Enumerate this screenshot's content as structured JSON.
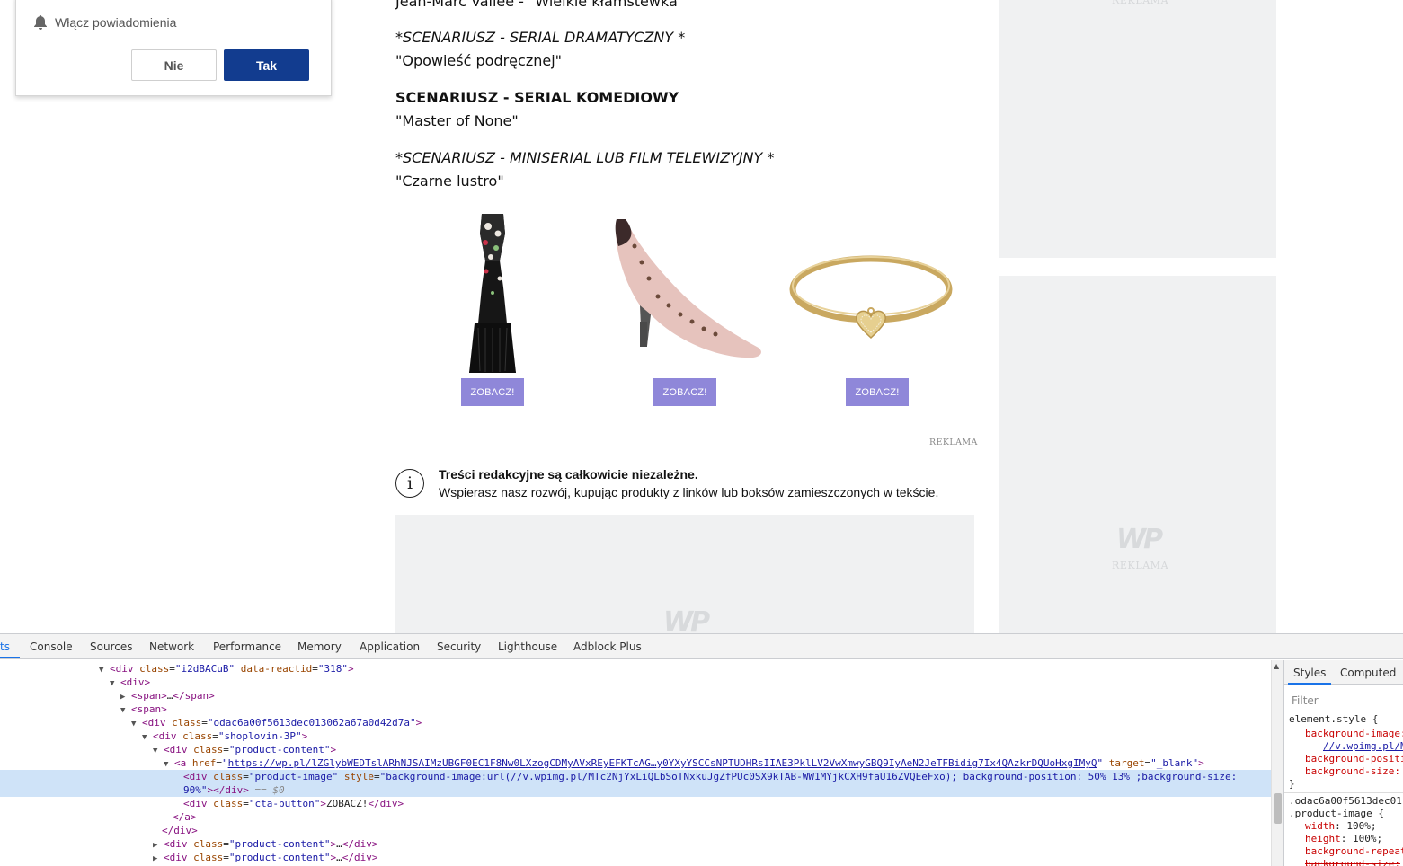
{
  "notification": {
    "text": "Włącz powiadomienia",
    "no_label": "Nie",
    "yes_label": "Tak",
    "accent_color": "#123c8f"
  },
  "article": {
    "partial_top_line": "Jean-Marc Vallée - \"Wielkie kłamstewka\"",
    "sections": [
      {
        "category": "*SCENARIUSZ - SERIAL DRAMATYCZNY *",
        "winner": "\"Opowieść podręcznej\""
      },
      {
        "category": "SCENARIUSZ - SERIAL KOMEDIOWY",
        "winner": "\"Master of None\""
      },
      {
        "category": "*SCENARIUSZ - MINISERIAL LUB FILM TELEWIZYJNY *",
        "winner": "\"Czarne lustro\""
      }
    ]
  },
  "products": [
    {
      "icon": "dress-image",
      "cta": "ZOBACZ!"
    },
    {
      "icon": "high-heel-shoe-image",
      "cta": "ZOBACZ!"
    },
    {
      "icon": "heart-bracelet-image",
      "cta": "ZOBACZ!"
    }
  ],
  "cta_color": "#8f87d9",
  "ad_small_label": "REKLAMA",
  "info": {
    "icon": "info-icon",
    "title": "Treści redakcyjne są całkowicie niezależne.",
    "text": "Wspierasz nasz rozwój, kupując produkty z linków lub boksów zamieszczonych w tekście."
  },
  "ads": {
    "logo": "WP",
    "label": "REKLAMA"
  },
  "devtools": {
    "tabs": [
      "ts",
      "Console",
      "Sources",
      "Network",
      "Performance",
      "Memory",
      "Application",
      "Security",
      "Lighthouse",
      "Adblock Plus"
    ],
    "dom": {
      "r1_tag": "div",
      "r1_attr": "class",
      "r1_val": "i2dBACuB",
      "r1_attr2": "data-reactid",
      "r1_val2": "318",
      "r2_tag": "div",
      "r3_tag": "span",
      "r3_ellipsis": "…",
      "r4_tag": "span",
      "r5_tag": "div",
      "r5_attr": "class",
      "r5_val": "odac6a00f5613dec013062a67a0d42d7a",
      "r6_tag": "div",
      "r6_attr": "class",
      "r6_val": "shoplovin-3P",
      "r7_tag": "div",
      "r7_attr": "class",
      "r7_val": "product-content",
      "r8_tag": "a",
      "r8_attr": "href",
      "r8_href": "https://wp.pl/lZGlybWEDTslARhNJSAIMzUBGF0EC1F8Nw0LXzogCDMyAVxREyEFKTcAG…y0YXyYSCCsNPTUDHRsIIAE3PklLV2VwXmwyGBQ9IyAeN2JeTFBidig7Ix4QAzkrDQUoHxgIMyQ",
      "r8_attr2": "target",
      "r8_val2": "_blank",
      "r9_tag": "div",
      "r9_attr": "class",
      "r9_val": "product-image",
      "r9_attr2": "style",
      "r9_style_1": "background-image:url(//v.wpimg.pl/MTc2NjYxLiQLbSoTNxkuJgZfPUc0SX9kTAB-WW1MYjkCXH9faU16ZVQEeFxo); background-position: 50% 13% ;background-size:",
      "r9_style_2": "90%",
      "r9_eq": "== $0",
      "r10_tag": "div",
      "r10_attr": "class",
      "r10_val": "cta-button",
      "r10_text": "ZOBACZ!",
      "r11_close": "/a",
      "r12_close": "/div",
      "r13_tag": "div",
      "r13_attr": "class",
      "r13_val": "product-content",
      "r13_ellipsis": "…",
      "r14_tag": "div",
      "r14_attr": "class",
      "r14_val": "product-content",
      "r14_ellipsis": "…"
    },
    "styles": {
      "tabs": [
        "Styles",
        "Computed"
      ],
      "filter_placeholder": "Filter",
      "element_style": "element.style {",
      "p1": "background-image:",
      "p1v": "//v.wpimg.pl/M",
      "p2": "background-positi",
      "p3": "background-size:",
      "close": "}",
      "rule_sel_1": ".odac6a00f5613dec01",
      "rule_sel_2": ".product-image {",
      "w_name": "width",
      "w_val": "100%;",
      "h_name": "height",
      "h_val": "100%;",
      "rep_name": "background-repeat",
      "size_name": "background-size:"
    }
  }
}
